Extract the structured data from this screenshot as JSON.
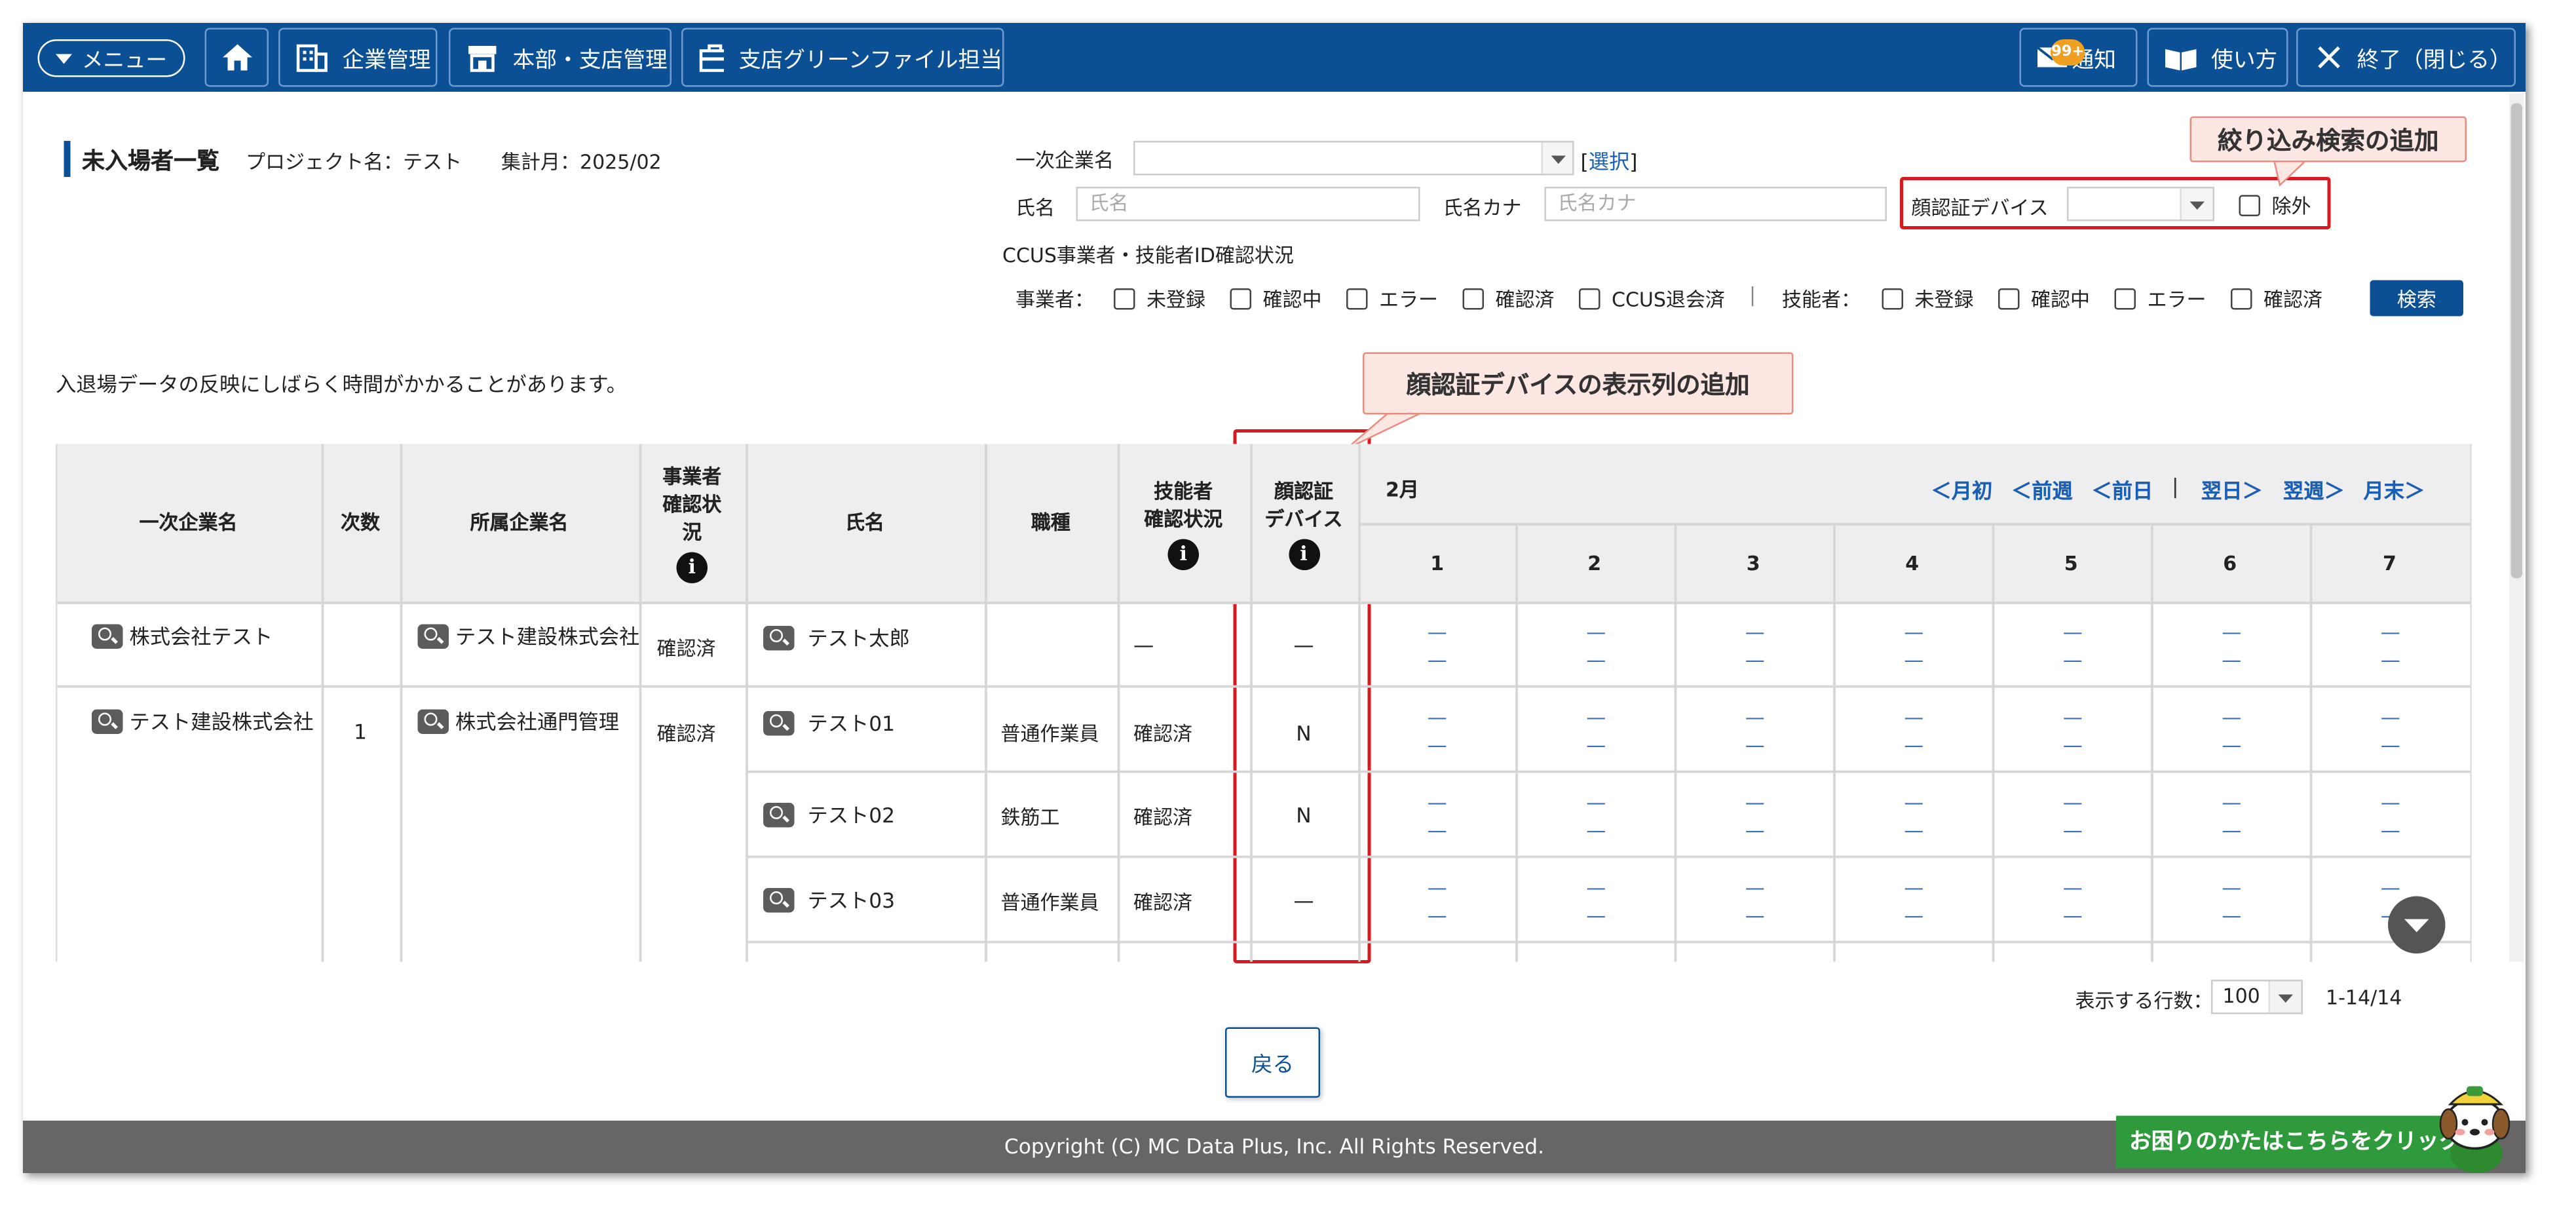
{
  "nav": {
    "menu": "メニュー",
    "company_mgmt": "企業管理",
    "hq_branch_mgmt": "本部・支店管理",
    "branch_green_file": "支店グリーンファイル担当",
    "notify_badge": "99+",
    "notify": "通知",
    "howto": "使い方",
    "exit": "終了（閉じる）"
  },
  "page": {
    "title": "未入場者一覧",
    "project_label": "プロジェクト名：テスト",
    "month_label": "集計月：2025/02",
    "notice": "入退場データの反映にしばらく時間がかかることがあります。"
  },
  "search": {
    "primary_company_label": "一次企業名",
    "select_link_open": "[",
    "select_link": "選択",
    "select_link_close": "]",
    "name_label": "氏名",
    "name_placeholder": "氏名",
    "kana_label": "氏名カナ",
    "kana_placeholder": "氏名カナ",
    "face_device_label": "顔認証デバイス",
    "exclude_label": "除外",
    "ccus_status_label": "CCUS事業者・技能者ID確認状況",
    "business_label": "事業者：",
    "business_options": [
      "未登録",
      "確認中",
      "エラー",
      "確認済",
      "CCUS退会済"
    ],
    "separator": "|",
    "worker_label": "技能者：",
    "worker_options": [
      "未登録",
      "確認中",
      "エラー",
      "確認済"
    ],
    "search_button": "検索"
  },
  "callouts": {
    "filter": "絞り込み検索の追加",
    "column": "顔認証デバイスの表示列の追加"
  },
  "table": {
    "headers": {
      "primary_company": "一次企業名",
      "tier": "次数",
      "affiliated_company": "所属企業名",
      "business_status_1": "事業者",
      "business_status_2": "確認状",
      "business_status_3": "況",
      "name": "氏名",
      "trade": "職種",
      "worker_status_1": "技能者",
      "worker_status_2": "確認状況",
      "face_device_1": "顔認証",
      "face_device_2": "デバイス",
      "month": "2月",
      "info_icon": "i"
    },
    "day_nav": {
      "month_start": "＜月初",
      "prev_week": "＜前週",
      "prev_day": "＜前日",
      "sep": "|",
      "next_day": "翌日＞",
      "next_week": "翌週＞",
      "month_end": "月末＞"
    },
    "days": [
      "1",
      "2",
      "3",
      "4",
      "5",
      "6",
      "7"
    ],
    "rows": [
      {
        "primary_company": "株式会社テスト",
        "tier": "",
        "affiliated_company": "テスト建設株式会社",
        "business_status": "確認済",
        "name": "テスト太郎",
        "trade": "",
        "worker_status": "—",
        "face_device": "—"
      },
      {
        "primary_company": "テスト建設株式会社",
        "tier": "1",
        "affiliated_company": "株式会社通門管理",
        "business_status": "確認済",
        "name": "テスト01",
        "trade": "普通作業員",
        "worker_status": "確認済",
        "face_device": "N"
      },
      {
        "primary_company": "",
        "tier": "",
        "affiliated_company": "",
        "business_status": "",
        "name": "テスト02",
        "trade": "鉄筋工",
        "worker_status": "確認済",
        "face_device": "N"
      },
      {
        "primary_company": "",
        "tier": "",
        "affiliated_company": "",
        "business_status": "",
        "name": "テスト03",
        "trade": "普通作業員",
        "worker_status": "確認済",
        "face_device": "—"
      }
    ],
    "day_cell_value": "—"
  },
  "pagination": {
    "rows_label": "表示する行数：",
    "rows_value": "100",
    "range": "1-14/14"
  },
  "back_button": "戻る",
  "footer": {
    "copyright": "Copyright (C) MC Data Plus, Inc. All Rights Reserved.",
    "help": "お困りのかたはこちらをクリック"
  },
  "colors": {
    "navy": "#0b4f94",
    "callout_border": "#d71920",
    "help_green": "#2e9a3c",
    "footer_gray": "#666666"
  }
}
